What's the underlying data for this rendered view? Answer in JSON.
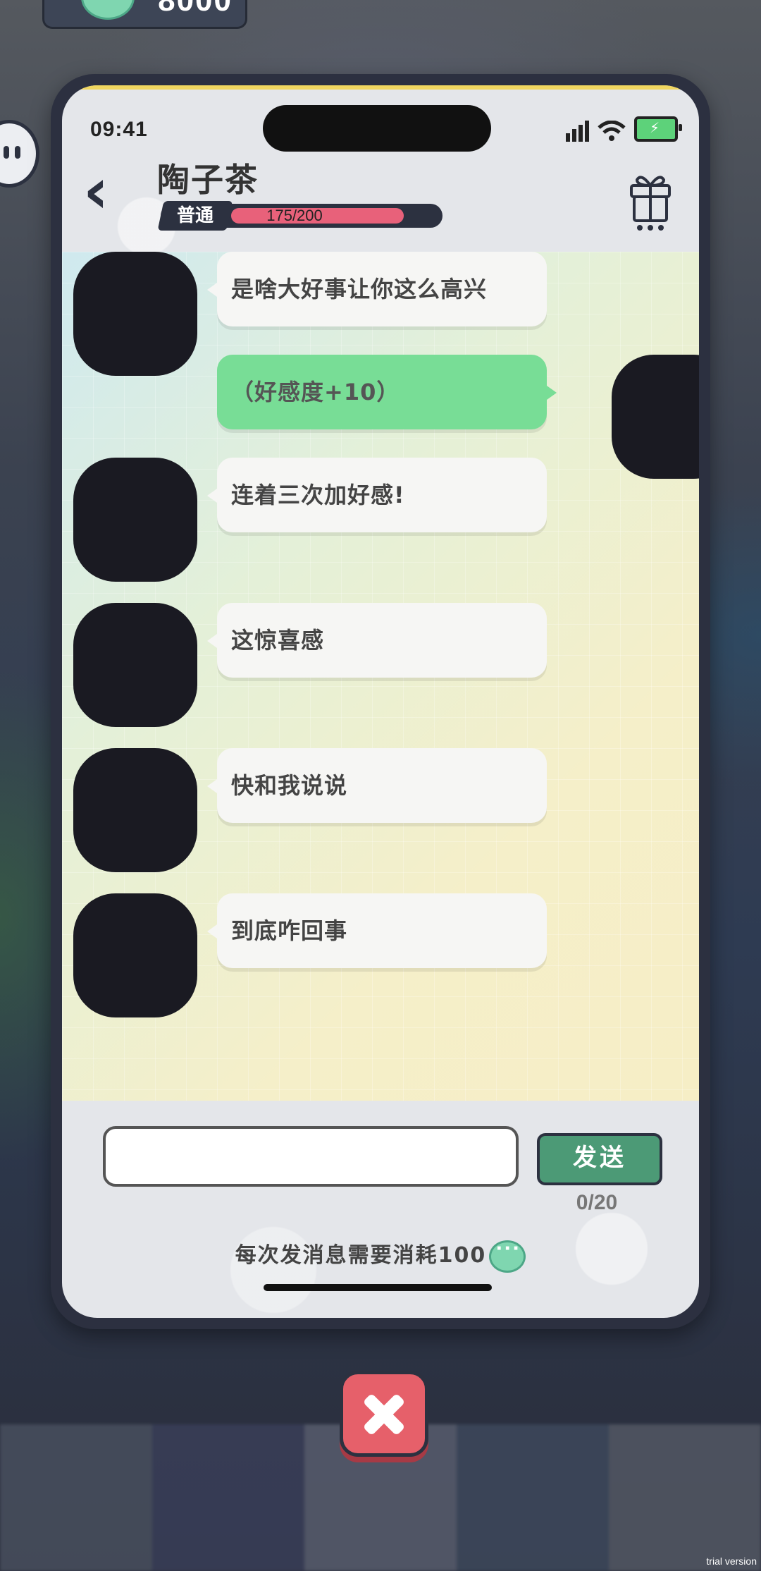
{
  "currency": {
    "value": "8000"
  },
  "status_bar": {
    "time": "09:41"
  },
  "header": {
    "back_glyph": "‹",
    "character_name": "陶子茶",
    "relationship_level": "普通",
    "affection_text": "175/200",
    "affection_progress": 0.875
  },
  "messages": [
    {
      "side": "left",
      "text": "是啥大好事让你这么高兴"
    },
    {
      "side": "right",
      "text": "（好感度+10）"
    },
    {
      "side": "left",
      "text": "连着三次加好感!"
    },
    {
      "side": "left",
      "text": "这惊喜感"
    },
    {
      "side": "left",
      "text": "快和我说说"
    },
    {
      "side": "left",
      "text": "到底咋回事"
    }
  ],
  "input": {
    "value": "",
    "placeholder": ""
  },
  "send_button": {
    "label": "发送"
  },
  "char_counter": "0/20",
  "cost_note": "每次发消息需要消耗100",
  "watermark": "trial version",
  "colors": {
    "accent_green": "#4c9a76",
    "player_bubble": "#78dd96",
    "affection_bar": "#e8617a",
    "close_red": "#e6606a",
    "frame": "#2c3040"
  }
}
